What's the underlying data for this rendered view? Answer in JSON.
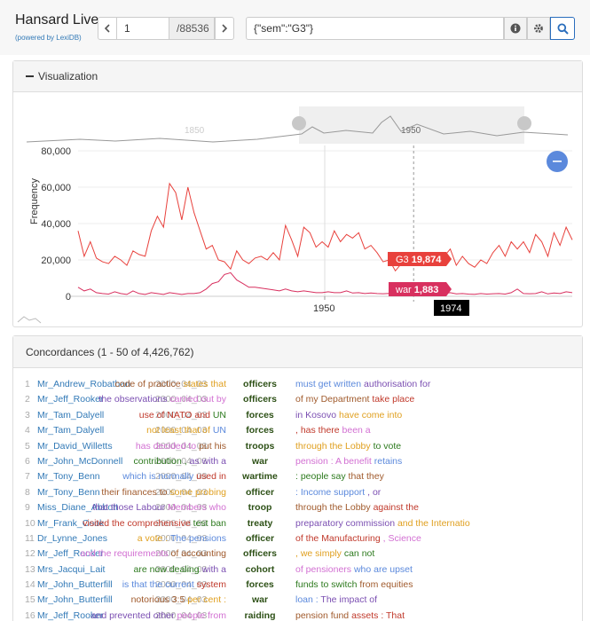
{
  "header": {
    "title": "Hansard Live",
    "subtitle": "(powered by LexiDB)",
    "page": "1",
    "total": "/88536",
    "query": "{\"sem\":\"G3\"}"
  },
  "viz": {
    "title": "Visualization",
    "legend": [
      {
        "name": "G3",
        "value": "19,874",
        "color": "#e8413c"
      },
      {
        "name": "war",
        "value": "1,883",
        "color": "#d8305f"
      }
    ],
    "cursor_label": "1974",
    "accent": "#5b89dc"
  },
  "chart_data": {
    "type": "line",
    "title": "",
    "xlabel": "",
    "ylabel": "Frequency",
    "yticks": [
      "0",
      "20,000",
      "40,000",
      "60,000",
      "80,000"
    ],
    "ylim": [
      0,
      80000
    ],
    "xticks": [
      "1950"
    ],
    "overview_ticks": [
      "1850",
      "1950"
    ],
    "xlim": [
      1919,
      2000
    ],
    "cursor_year": 1974,
    "series": [
      {
        "name": "G3",
        "color": "#e8413c",
        "x": [
          1919,
          1920,
          1921,
          1922,
          1923,
          1924,
          1925,
          1926,
          1927,
          1928,
          1929,
          1930,
          1931,
          1932,
          1933,
          1934,
          1935,
          1936,
          1937,
          1938,
          1939,
          1940,
          1941,
          1942,
          1943,
          1944,
          1945,
          1946,
          1947,
          1948,
          1949,
          1950,
          1951,
          1952,
          1953,
          1954,
          1955,
          1956,
          1957,
          1958,
          1959,
          1960,
          1961,
          1962,
          1963,
          1964,
          1965,
          1966,
          1967,
          1968,
          1969,
          1970,
          1971,
          1972,
          1973,
          1974,
          1975,
          1976,
          1977,
          1978,
          1979,
          1980,
          1981,
          1982,
          1983,
          1984,
          1985,
          1986,
          1987,
          1988,
          1989,
          1990,
          1991,
          1992,
          1993,
          1994,
          1995,
          1996,
          1997,
          1998,
          1999,
          2000
        ],
        "values": [
          36000,
          22000,
          30000,
          21000,
          19000,
          18000,
          22000,
          20000,
          17000,
          25000,
          23000,
          22000,
          36000,
          44000,
          38000,
          62000,
          57000,
          42000,
          60000,
          46000,
          36000,
          26000,
          28000,
          20000,
          19000,
          15000,
          25000,
          20000,
          18000,
          21000,
          22000,
          20000,
          24000,
          20000,
          39000,
          31000,
          22000,
          38000,
          35000,
          27000,
          30000,
          27000,
          36000,
          30000,
          34000,
          32000,
          35000,
          26000,
          28000,
          24000,
          19000,
          20000,
          14000,
          18000,
          21000,
          19874,
          17000,
          20000,
          21000,
          24000,
          22000,
          26000,
          17000,
          22000,
          18000,
          16000,
          20000,
          18000,
          24000,
          28000,
          22000,
          30000,
          26000,
          30000,
          24000,
          34000,
          30000,
          22000,
          35000,
          28000,
          38000,
          31000
        ]
      },
      {
        "name": "war",
        "color": "#d8305f",
        "x": [
          1919,
          1920,
          1921,
          1922,
          1923,
          1924,
          1925,
          1926,
          1927,
          1928,
          1929,
          1930,
          1931,
          1932,
          1933,
          1934,
          1935,
          1936,
          1937,
          1938,
          1939,
          1940,
          1941,
          1942,
          1943,
          1944,
          1945,
          1946,
          1947,
          1948,
          1949,
          1950,
          1951,
          1952,
          1953,
          1954,
          1955,
          1956,
          1957,
          1958,
          1959,
          1960,
          1961,
          1962,
          1963,
          1964,
          1965,
          1966,
          1967,
          1968,
          1969,
          1970,
          1971,
          1972,
          1973,
          1974,
          1975,
          1976,
          1977,
          1978,
          1979,
          1980,
          1981,
          1982,
          1983,
          1984,
          1985,
          1986,
          1987,
          1988,
          1989,
          1990,
          1991,
          1992,
          1993,
          1994,
          1995,
          1996,
          1997,
          1998,
          1999,
          2000
        ],
        "values": [
          5000,
          3000,
          4000,
          2000,
          1500,
          1200,
          2500,
          1500,
          1000,
          3000,
          1500,
          1000,
          2000,
          1500,
          1000,
          2000,
          1500,
          1000,
          1500,
          1500,
          2000,
          4000,
          7000,
          8000,
          12000,
          13000,
          9000,
          7000,
          5000,
          5000,
          4500,
          4000,
          3500,
          3000,
          4000,
          3000,
          2500,
          3000,
          2500,
          2000,
          2000,
          2500,
          2000,
          2000,
          3000,
          1800,
          2000,
          1500,
          1800,
          1500,
          1400,
          1600,
          1300,
          1500,
          1800,
          1883,
          1600,
          1500,
          1400,
          1700,
          1500,
          2000,
          1300,
          1500,
          1200,
          1100,
          1500,
          1200,
          1400,
          1500,
          1200,
          2000,
          4000,
          1500,
          1400,
          1500,
          2500,
          1300,
          1800,
          1500,
          2500,
          2000
        ]
      }
    ]
  },
  "concordances": {
    "title": "Concordances (1 - 50 of 4,426,762)",
    "rows": [
      {
        "n": "1",
        "name": "Mr_Andrew_Robathan",
        "date": "2000_04_03",
        "left": [
          "code of practice ",
          "states that"
        ],
        "kw": "officers",
        "right": [
          "must get written ",
          "authorisation for"
        ]
      },
      {
        "n": "2",
        "name": "Mr_Jeff_Rooker",
        "date": "2000_04_03",
        "left": [
          "the observations ",
          "carried out by"
        ],
        "kw": "officers",
        "right": [
          "of my Department ",
          "take place"
        ]
      },
      {
        "n": "3",
        "name": "Mr_Tam_Dalyell",
        "date": "2000_04_03",
        "left": [
          "use of NATO and ",
          "UN"
        ],
        "kw": "forces",
        "right": [
          "in Kosovo ",
          "have come into"
        ]
      },
      {
        "n": "4",
        "name": "Mr_Tam_Dalyell",
        "date": "2000_04_03",
        "left": [
          "not least that of ",
          "UN"
        ],
        "kw": "forces",
        "right": [
          ", has there ",
          "been a"
        ]
      },
      {
        "n": "5",
        "name": "Mr_David_Willetts",
        "date": "2000_04_03",
        "left": [
          "has decided to ",
          "put his"
        ],
        "kw": "troops",
        "right": [
          "through the Lobby ",
          "to vote"
        ]
      },
      {
        "n": "6",
        "name": "Mr_John_McDonnell",
        "date": "2000_04_03",
        "left": [
          "contribution , ",
          "as with a"
        ],
        "kw": "war",
        "right": [
          "pension : A benefit ",
          "retains"
        ]
      },
      {
        "n": "7",
        "name": "Mr_Tony_Benn",
        "date": "2000_04_03",
        "left": [
          "which is normally ",
          "used in"
        ],
        "kw": "wartime",
        "right": [
          ": people say ",
          "that they"
        ]
      },
      {
        "n": "8",
        "name": "Mr_Tony_Benn",
        "date": "2000_04_03",
        "left": [
          "their finances to ",
          "some probing"
        ],
        "kw": "officer",
        "right": [
          ": Income support ",
          ", or"
        ]
      },
      {
        "n": "9",
        "name": "Miss_Diane_Abbott",
        "date": "2000_04_03",
        "left": [
          "that those Labour ",
          "Members who"
        ],
        "kw": "troop",
        "right": [
          "through the Lobby ",
          "against the"
        ]
      },
      {
        "n": "10",
        "name": "Mr_Frank_Cook",
        "date": "2000_04_03",
        "left": [
          "visited the comprehensive ",
          "test ban"
        ],
        "kw": "treaty",
        "right": [
          "preparatory commission ",
          "and the Internatio"
        ]
      },
      {
        "n": "11",
        "name": "Dr_Lynne_Jones",
        "date": "2000_04_03",
        "left": [
          "a vote : ",
          "The pensions"
        ],
        "kw": "officer",
        "right": [
          "of the Manufacturing ",
          ", Science"
        ]
      },
      {
        "n": "12",
        "name": "Mr_Jeff_Rooker",
        "date": "2000_04_03",
        "left": [
          "and the requirements ",
          "of accounting"
        ],
        "kw": "officers",
        "right": [
          ", we simply ",
          "can not"
        ]
      },
      {
        "n": "13",
        "name": "Mrs_Jacqui_Lait",
        "date": "2000_04_03",
        "left": [
          "are now dealing ",
          "with a"
        ],
        "kw": "cohort",
        "right": [
          "of pensioners ",
          "who are upset"
        ]
      },
      {
        "n": "14",
        "name": "Mr_John_Butterfill",
        "date": "2000_04_03",
        "left": [
          "is that the current ",
          "system"
        ],
        "kw": "forces",
        "right": [
          "funds to switch ",
          "from equities"
        ]
      },
      {
        "n": "15",
        "name": "Mr_John_Butterfill",
        "date": "2000_04_03",
        "left": [
          "notorious 3:5 ",
          "per cent :"
        ],
        "kw": "war",
        "right": [
          "loan : ",
          "The impact of"
        ]
      },
      {
        "n": "16",
        "name": "Mr_Jeff_Rooker",
        "date": "2000_04_03",
        "left": [
          "and prevented other ",
          "people from"
        ],
        "kw": "raiding",
        "right": [
          "pension fund ",
          "assets : That"
        ]
      }
    ]
  }
}
